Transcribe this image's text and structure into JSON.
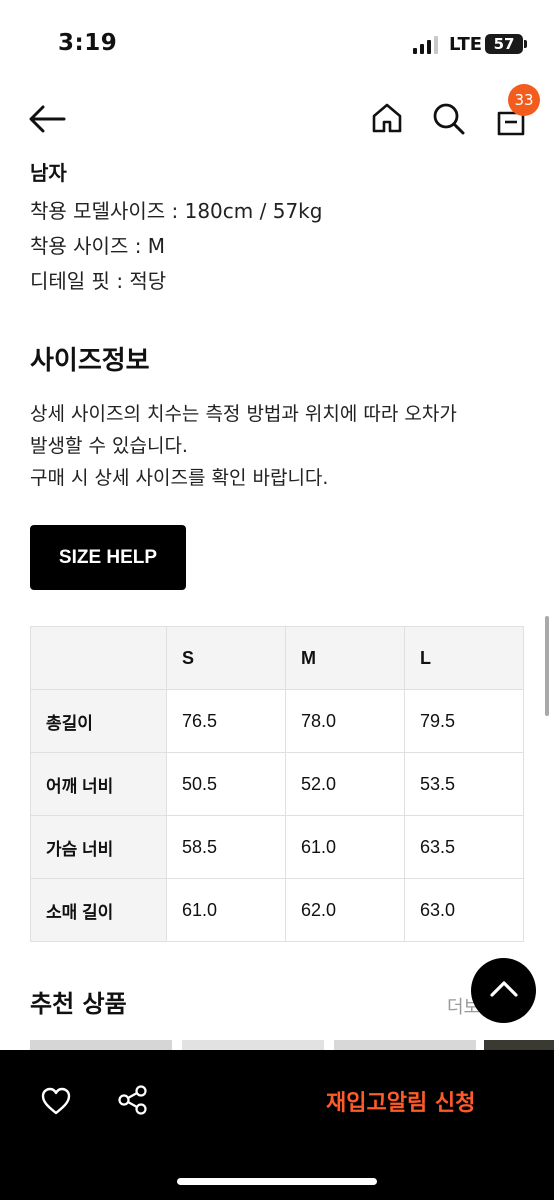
{
  "status_bar": {
    "time": "3:19",
    "network": "LTE",
    "battery": "57"
  },
  "header": {
    "cart_count": "33"
  },
  "model_info": {
    "gender": "남자",
    "lines": [
      "착용 모델사이즈 : 180cm / 57kg",
      "착용 사이즈 : M",
      "디테일 핏 : 적당"
    ]
  },
  "size_info": {
    "heading": "사이즈정보",
    "description": [
      "상세 사이즈의 치수는 측정 방법과 위치에 따라 오차가",
      "발생할 수 있습니다.",
      "구매 시 상세 사이즈를 확인 바랍니다."
    ],
    "help_button": "SIZE HELP"
  },
  "size_table": {
    "headers": [
      "",
      "S",
      "M",
      "L"
    ],
    "rows": [
      [
        "총길이",
        "76.5",
        "78.0",
        "79.5"
      ],
      [
        "어깨 너비",
        "50.5",
        "52.0",
        "53.5"
      ],
      [
        "가슴 너비",
        "58.5",
        "61.0",
        "63.5"
      ],
      [
        "소매 길이",
        "61.0",
        "62.0",
        "63.0"
      ]
    ]
  },
  "recommended": {
    "heading": "추천 상품",
    "more": "더보"
  },
  "bottom_bar": {
    "restock_label": "재입고알림 신청"
  },
  "icons": [
    "back-arrow-icon",
    "home-icon",
    "search-icon",
    "shopping-bag-icon",
    "chevron-up-icon",
    "heart-icon",
    "share-icon"
  ],
  "colors": {
    "accent": "#f25c1c",
    "restock_text": "#ff5a2a",
    "bottom_bar": "#000000"
  }
}
